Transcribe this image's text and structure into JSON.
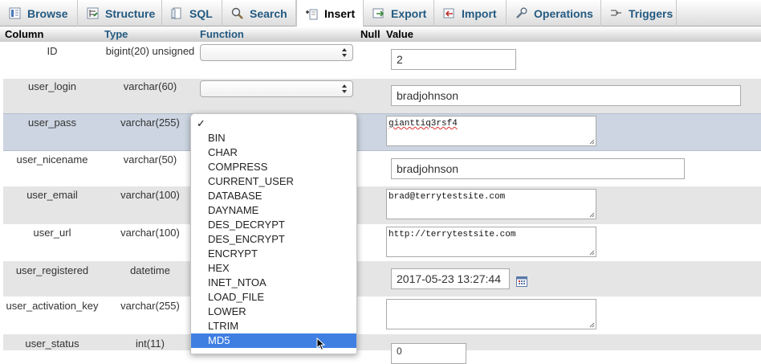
{
  "tabs": [
    {
      "label": "Browse",
      "icon": "browse-icon"
    },
    {
      "label": "Structure",
      "icon": "structure-icon"
    },
    {
      "label": "SQL",
      "icon": "sql-icon"
    },
    {
      "label": "Search",
      "icon": "search-icon"
    },
    {
      "label": "Insert",
      "icon": "insert-icon",
      "active": true
    },
    {
      "label": "Export",
      "icon": "export-icon"
    },
    {
      "label": "Import",
      "icon": "import-icon"
    },
    {
      "label": "Operations",
      "icon": "wrench-icon"
    },
    {
      "label": "Triggers",
      "icon": "triggers-icon"
    }
  ],
  "headers": {
    "column": "Column",
    "type": "Type",
    "function": "Function",
    "null": "Null",
    "value": "Value"
  },
  "rows": [
    {
      "column": "ID",
      "type": "bigint(20) unsigned",
      "value": "2"
    },
    {
      "column": "user_login",
      "type": "varchar(60)",
      "value": "bradjohnson"
    },
    {
      "column": "user_pass",
      "type": "varchar(255)",
      "value": "gianttiq3rsf4"
    },
    {
      "column": "user_nicename",
      "type": "varchar(50)",
      "value": "bradjohnson"
    },
    {
      "column": "user_email",
      "type": "varchar(100)",
      "value": "brad@terrytestsite.com"
    },
    {
      "column": "user_url",
      "type": "varchar(100)",
      "value": "http://terrytestsite.com"
    },
    {
      "column": "user_registered",
      "type": "datetime",
      "value": "2017-05-23 13:27:44"
    },
    {
      "column": "user_activation_key",
      "type": "varchar(255)",
      "value": ""
    },
    {
      "column": "user_status",
      "type": "int(11)",
      "value": "0"
    }
  ],
  "function_dropdown": {
    "checked_mark": "✓",
    "options": [
      "BIN",
      "CHAR",
      "COMPRESS",
      "CURRENT_USER",
      "DATABASE",
      "DAYNAME",
      "DES_DECRYPT",
      "DES_ENCRYPT",
      "ENCRYPT",
      "HEX",
      "INET_NTOA",
      "LOAD_FILE",
      "LOWER",
      "LTRIM",
      "MD5"
    ],
    "highlighted": "MD5"
  },
  "colors": {
    "tab_text": "#235a81",
    "highlight_row": "#ccd5e1",
    "dropdown_selected": "#3f7fe2"
  }
}
